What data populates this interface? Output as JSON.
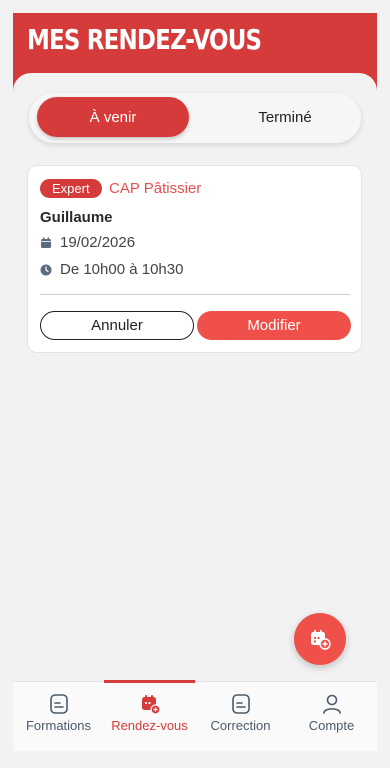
{
  "header": {
    "title": "MES RENDEZ-VOUS"
  },
  "tabs": [
    {
      "label": "À venir",
      "active": true
    },
    {
      "label": "Terminé",
      "active": false
    }
  ],
  "appointment": {
    "badge": "Expert",
    "course": "CAP Pâtissier",
    "name": "Guillaume",
    "date": "19/02/2026",
    "time": "De 10h00 à 10h30",
    "cancel_label": "Annuler",
    "modify_label": "Modifier"
  },
  "fab": {
    "icon": "calendar-add-icon"
  },
  "nav": [
    {
      "label": "Formations",
      "icon": "document-icon",
      "active": false
    },
    {
      "label": "Rendez-vous",
      "icon": "calendar-icon",
      "active": true
    },
    {
      "label": "Correction",
      "icon": "document-icon",
      "active": false
    },
    {
      "label": "Compte",
      "icon": "user-icon",
      "active": false
    }
  ],
  "colors": {
    "primary": "#d63b3b",
    "accent": "#f0504a",
    "course_text": "#e94e4e"
  }
}
